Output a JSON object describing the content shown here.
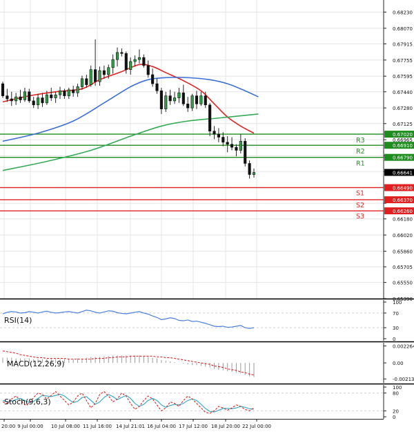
{
  "chart_data": [
    {
      "type": "candlestick",
      "panel": "price",
      "y_ticks": [
        0.6823,
        0.6807,
        0.67915,
        0.67755,
        0.67595,
        0.6744,
        0.6728,
        0.67125,
        0.66965,
        0.66805,
        0.6665,
        0.66335,
        0.6618,
        0.6602,
        0.6586,
        0.65705,
        0.6555,
        0.6539
      ],
      "y_tick_labels": [
        "0.68230",
        "0.68070",
        "0.67915",
        "0.67755",
        "0.67595",
        "0.67440",
        "0.67280",
        "0.67125",
        "0.66965",
        "0.66805",
        "0.66650",
        "0.66335",
        "0.66180",
        "0.66020",
        "0.65860",
        "0.65705",
        "0.65550",
        "0.65390"
      ],
      "ylim": [
        0.6539,
        0.6835
      ],
      "x_ticks": [
        "20:00",
        "9 Jul 00:00",
        "10 Jul 08:00",
        "11 Jul 16:00",
        "14 Jul 21:01",
        "16 Jul 04:00",
        "17 Jul 12:00",
        "18 Jul 20:00",
        "22 Jul 00:00"
      ],
      "current_price": {
        "value": 0.66641,
        "label": "0.66641"
      },
      "levels": [
        {
          "name": "R3",
          "value": 0.6702,
          "label": "0.67020",
          "color": "#1e8c1e"
        },
        {
          "name": "R2",
          "value": 0.6691,
          "label": "0.66910",
          "color": "#1e8c1e"
        },
        {
          "name": "R1",
          "value": 0.6679,
          "label": "0.66790",
          "color": "#1e8c1e"
        },
        {
          "name": "S1",
          "value": 0.6649,
          "label": "0.66490",
          "color": "#e02020"
        },
        {
          "name": "S2",
          "value": 0.6637,
          "label": "0.66370",
          "color": "#e02020"
        },
        {
          "name": "S3",
          "value": 0.6626,
          "label": "0.66260",
          "color": "#e02020"
        }
      ],
      "candles": [
        [
          0.6752,
          0.6754,
          0.6738,
          0.674
        ],
        [
          0.674,
          0.6747,
          0.6734,
          0.6737
        ],
        [
          0.6737,
          0.6744,
          0.673,
          0.6735
        ],
        [
          0.6735,
          0.6743,
          0.6731,
          0.6739
        ],
        [
          0.6739,
          0.6746,
          0.6733,
          0.6736
        ],
        [
          0.6736,
          0.6748,
          0.6734,
          0.6744
        ],
        [
          0.6744,
          0.6747,
          0.6733,
          0.6735
        ],
        [
          0.6735,
          0.6739,
          0.6728,
          0.6731
        ],
        [
          0.6731,
          0.6742,
          0.6727,
          0.6738
        ],
        [
          0.6738,
          0.6743,
          0.6729,
          0.6733
        ],
        [
          0.6733,
          0.6745,
          0.6731,
          0.6741
        ],
        [
          0.6741,
          0.6748,
          0.6735,
          0.6738
        ],
        [
          0.6738,
          0.6744,
          0.6733,
          0.6741
        ],
        [
          0.6741,
          0.6749,
          0.6737,
          0.6745
        ],
        [
          0.6745,
          0.6747,
          0.6737,
          0.674
        ],
        [
          0.674,
          0.6748,
          0.6737,
          0.6746
        ],
        [
          0.6746,
          0.675,
          0.6739,
          0.6743
        ],
        [
          0.6743,
          0.6752,
          0.6739,
          0.6749
        ],
        [
          0.6749,
          0.676,
          0.6746,
          0.6757
        ],
        [
          0.6757,
          0.6761,
          0.6748,
          0.6751
        ],
        [
          0.6751,
          0.677,
          0.6749,
          0.6766
        ],
        [
          0.6766,
          0.6796,
          0.675,
          0.6754
        ],
        [
          0.6754,
          0.6769,
          0.675,
          0.6765
        ],
        [
          0.6765,
          0.677,
          0.6757,
          0.6761
        ],
        [
          0.6761,
          0.6771,
          0.6757,
          0.6768
        ],
        [
          0.6768,
          0.6781,
          0.6762,
          0.6776
        ],
        [
          0.6776,
          0.6788,
          0.6769,
          0.6783
        ],
        [
          0.6783,
          0.6787,
          0.6779,
          0.6782
        ],
        [
          0.6782,
          0.6784,
          0.6762,
          0.6766
        ],
        [
          0.6766,
          0.6778,
          0.6761,
          0.6774
        ],
        [
          0.6774,
          0.678,
          0.6769,
          0.6776
        ],
        [
          0.6776,
          0.6786,
          0.6772,
          0.6778
        ],
        [
          0.6778,
          0.6781,
          0.6768,
          0.677
        ],
        [
          0.677,
          0.6775,
          0.6758,
          0.6761
        ],
        [
          0.6761,
          0.6767,
          0.6749,
          0.6752
        ],
        [
          0.6752,
          0.6757,
          0.6742,
          0.6745
        ],
        [
          0.6745,
          0.6748,
          0.6722,
          0.6727
        ],
        [
          0.6727,
          0.6744,
          0.6724,
          0.674
        ],
        [
          0.674,
          0.6746,
          0.6731,
          0.6735
        ],
        [
          0.6735,
          0.6744,
          0.6732,
          0.6738
        ],
        [
          0.6738,
          0.6748,
          0.6733,
          0.6743
        ],
        [
          0.6743,
          0.6751,
          0.673,
          0.6732
        ],
        [
          0.6732,
          0.6739,
          0.6724,
          0.6728
        ],
        [
          0.6728,
          0.6742,
          0.6725,
          0.674
        ],
        [
          0.674,
          0.6745,
          0.6727,
          0.6732
        ],
        [
          0.6732,
          0.6744,
          0.673,
          0.674
        ],
        [
          0.674,
          0.6744,
          0.6728,
          0.6731
        ],
        [
          0.6731,
          0.6733,
          0.67,
          0.6705
        ],
        [
          0.6705,
          0.671,
          0.6697,
          0.6702
        ],
        [
          0.6702,
          0.6708,
          0.6694,
          0.6699
        ],
        [
          0.6699,
          0.6704,
          0.669,
          0.6694
        ],
        [
          0.6694,
          0.67,
          0.6684,
          0.6692
        ],
        [
          0.6692,
          0.6699,
          0.6686,
          0.6689
        ],
        [
          0.6689,
          0.6692,
          0.668,
          0.6686
        ],
        [
          0.6686,
          0.6702,
          0.6683,
          0.6695
        ],
        [
          0.6695,
          0.6698,
          0.667,
          0.6673
        ],
        [
          0.6673,
          0.6676,
          0.6658,
          0.6662
        ],
        [
          0.6662,
          0.6668,
          0.6659,
          0.6664
        ]
      ],
      "overlays": [
        {
          "name": "MA fast",
          "color": "#e32222",
          "points": [
            [
              0,
              0.6734
            ],
            [
              6,
              0.674
            ],
            [
              12,
              0.6744
            ],
            [
              18,
              0.6747
            ],
            [
              22,
              0.6756
            ],
            [
              27,
              0.6764
            ],
            [
              31,
              0.6771
            ],
            [
              34,
              0.6769
            ],
            [
              37,
              0.6763
            ],
            [
              41,
              0.6755
            ],
            [
              45,
              0.6745
            ],
            [
              48,
              0.6732
            ],
            [
              51,
              0.6719
            ],
            [
              54,
              0.671
            ],
            [
              57,
              0.6703
            ]
          ]
        },
        {
          "name": "MA mid",
          "color": "#3b6fd6",
          "points": [
            [
              0,
              0.6695
            ],
            [
              8,
              0.6703
            ],
            [
              16,
              0.6715
            ],
            [
              23,
              0.6733
            ],
            [
              29,
              0.6749
            ],
            [
              33,
              0.6756
            ],
            [
              37,
              0.6758
            ],
            [
              42,
              0.6758
            ],
            [
              47,
              0.6756
            ],
            [
              51,
              0.6752
            ],
            [
              55,
              0.6745
            ],
            [
              58,
              0.6739
            ]
          ]
        },
        {
          "name": "MA slow",
          "color": "#33aa55",
          "points": [
            [
              0,
              0.6666
            ],
            [
              10,
              0.6675
            ],
            [
              20,
              0.6686
            ],
            [
              29,
              0.67
            ],
            [
              36,
              0.671
            ],
            [
              42,
              0.6715
            ],
            [
              49,
              0.6718
            ],
            [
              58,
              0.6722
            ]
          ]
        }
      ]
    },
    {
      "type": "line",
      "panel": "rsi",
      "title": "RSI(14)",
      "y_ticks": [
        100,
        70,
        30,
        0
      ],
      "ylim": [
        0,
        100
      ],
      "values": [
        68,
        72,
        74,
        73,
        70,
        71,
        74,
        72,
        70,
        73,
        75,
        72,
        70,
        71,
        73,
        74,
        72,
        70,
        74,
        78,
        76,
        72,
        70,
        73,
        76,
        75,
        71,
        69,
        68,
        70,
        72,
        74,
        70,
        67,
        62,
        58,
        52,
        54,
        57,
        55,
        50,
        49,
        51,
        47,
        48,
        45,
        42,
        38,
        34,
        33,
        34,
        31,
        32,
        34,
        36,
        30,
        28,
        30
      ]
    },
    {
      "type": "bar",
      "panel": "macd",
      "title": "MACD(12,26,9)",
      "y_ticks": [
        0.002264,
        0.0,
        -0.002137
      ],
      "y_tick_labels": [
        "0.002264",
        "0.00",
        "-0.002137"
      ],
      "ylim": [
        -0.0023,
        0.0024
      ],
      "values": [
        0.0007,
        0.0007,
        0.0007,
        0.0006,
        0.0006,
        0.0006,
        0.0006,
        0.0005,
        0.0005,
        0.0005,
        0.0005,
        0.0005,
        0.0005,
        0.0005,
        0.0005,
        0.0005,
        0.0005,
        0.0006,
        0.0006,
        0.0007,
        0.0008,
        0.0008,
        0.0008,
        0.0009,
        0.0009,
        0.001,
        0.001,
        0.001,
        0.001,
        0.001,
        0.001,
        0.001,
        0.0009,
        0.0008,
        0.0007,
        0.0006,
        0.0004,
        0.0003,
        0.0002,
        0.0001,
        0.0,
        -0.0001,
        -0.0002,
        -0.0003,
        -0.0003,
        -0.0004,
        -0.0005,
        -0.0006,
        -0.0008,
        -0.0009,
        -0.001,
        -0.0011,
        -0.0012,
        -0.0013,
        -0.0014,
        -0.0016,
        -0.0018,
        -0.0019
      ],
      "signal": [
        0.0016,
        0.0015,
        0.0014,
        0.0013,
        0.0011,
        0.001,
        0.0009,
        0.0008,
        0.0007,
        0.0007,
        0.0006,
        0.0006,
        0.0006,
        0.0006,
        0.0006,
        0.0005,
        0.0005,
        0.0005,
        0.0005,
        0.0005,
        0.0005,
        0.0006,
        0.0006,
        0.0006,
        0.0007,
        0.0007,
        0.0008,
        0.0008,
        0.0008,
        0.0009,
        0.0009,
        0.0009,
        0.0009,
        0.0009,
        0.0009,
        0.0008,
        0.0008,
        0.0007,
        0.0007,
        0.0006,
        0.0005,
        0.0004,
        0.0003,
        0.0002,
        0.0001,
        0.0,
        -0.0001,
        -0.0002,
        -0.0004,
        -0.0005,
        -0.0006,
        -0.0008,
        -0.0009,
        -0.001,
        -0.0012,
        -0.0013,
        -0.0015,
        -0.0016
      ]
    },
    {
      "type": "line",
      "panel": "stoch",
      "title": "Stoch(9,6,3)",
      "y_ticks": [
        100,
        80,
        20,
        0
      ],
      "ylim": [
        0,
        100
      ],
      "k": [
        50,
        45,
        60,
        70,
        55,
        40,
        45,
        65,
        80,
        75,
        60,
        72,
        85,
        70,
        55,
        40,
        50,
        70,
        80,
        55,
        30,
        45,
        75,
        85,
        70,
        50,
        60,
        80,
        70,
        45,
        25,
        35,
        55,
        70,
        60,
        40,
        20,
        30,
        50,
        45,
        35,
        55,
        70,
        60,
        45,
        30,
        15,
        12,
        20,
        35,
        30,
        22,
        30,
        40,
        35,
        25,
        20,
        30
      ],
      "d": [
        55,
        50,
        52,
        58,
        62,
        55,
        48,
        52,
        62,
        72,
        70,
        68,
        72,
        76,
        70,
        58,
        48,
        52,
        65,
        68,
        55,
        42,
        50,
        65,
        75,
        68,
        58,
        65,
        72,
        62,
        45,
        35,
        42,
        55,
        62,
        55,
        40,
        32,
        38,
        42,
        40,
        45,
        55,
        60,
        55,
        42,
        28,
        18,
        16,
        22,
        28,
        28,
        27,
        30,
        35,
        32,
        27,
        26
      ],
      "k_color": "#e32222",
      "d_color": "#2aa8c4"
    }
  ]
}
